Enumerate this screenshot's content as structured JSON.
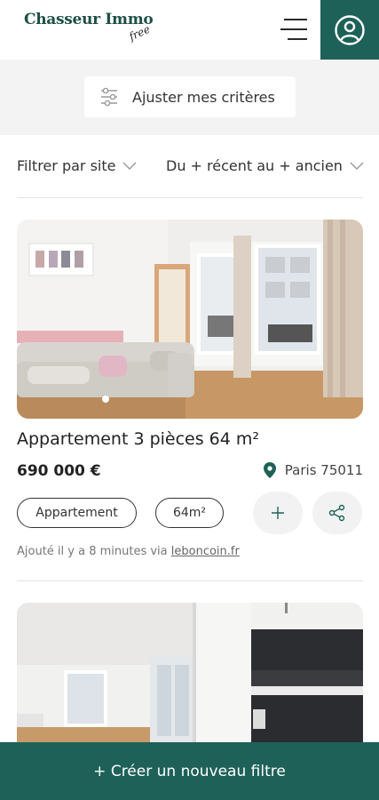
{
  "header": {
    "logo_main": "Chasseur Immo",
    "logo_sub": "free",
    "menu_icon": "hamburger-menu-icon",
    "account_icon": "user-circle-icon",
    "accent_color": "#1e6159"
  },
  "criteria": {
    "button_label": "Ajuster mes critères",
    "icon": "sliders-icon"
  },
  "filters": {
    "site_label": "Filtrer par site",
    "sort_label": "Du + récent au + ancien",
    "chevron_icon": "chevron-down-icon"
  },
  "listings": [
    {
      "title": "Appartement 3 pièces 64 m²",
      "price": "690 000 €",
      "location": "Paris 75011",
      "tags": [
        "Appartement",
        "64m²"
      ],
      "added_prefix": "Ajouté il y a 8 minutes via ",
      "source": "leboncoin.fr",
      "photo_count_indicator": 1
    },
    {
      "title": "",
      "price": "",
      "location": ""
    }
  ],
  "bottom_bar": {
    "label": "+ Créer un nouveau filtre"
  }
}
